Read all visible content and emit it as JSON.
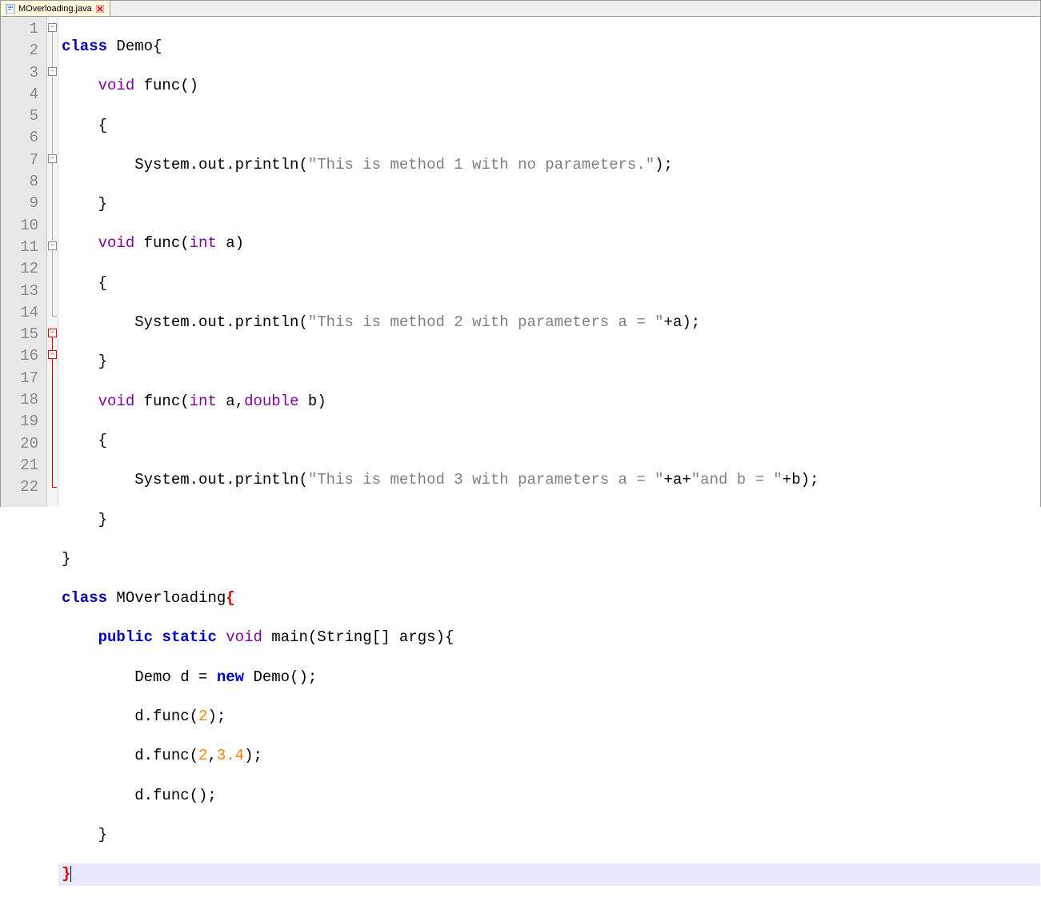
{
  "tab": {
    "filename": "MOverloading.java"
  },
  "gutter": {
    "lines": [
      "1",
      "2",
      "3",
      "4",
      "5",
      "6",
      "7",
      "8",
      "9",
      "10",
      "11",
      "12",
      "13",
      "14",
      "15",
      "16",
      "17",
      "18",
      "19",
      "20",
      "21",
      "22"
    ]
  },
  "code": {
    "l1": {
      "kw_class": "class",
      "name": "Demo",
      "brace": "{"
    },
    "l2": {
      "kw_void": "void",
      "name": "func",
      "paren": "()"
    },
    "l3": {
      "brace": "{"
    },
    "l4": {
      "sys": "System.out.println(",
      "str": "\"This is method 1 with no parameters.\"",
      "end": ");"
    },
    "l5": {
      "brace": "}"
    },
    "l6": {
      "kw_void": "void",
      "name": "func",
      "open": "(",
      "kw_int": "int",
      "a": " a",
      "close": ")"
    },
    "l7": {
      "brace": "{"
    },
    "l8": {
      "sys": "System.out.println(",
      "str": "\"This is method 2 with parameters a = \"",
      "plus1": "+",
      "a": "a",
      "end": ");"
    },
    "l9": {
      "brace": "}"
    },
    "l10": {
      "kw_void": "void",
      "name": "func",
      "open": "(",
      "kw_int": "int",
      "a": " a,",
      "kw_double": "double",
      "b": " b",
      "close": ")"
    },
    "l11": {
      "brace": "{"
    },
    "l12": {
      "sys": "System.out.println(",
      "str1": "\"This is method 3 with parameters a = \"",
      "plus1": "+",
      "a": "a",
      "plus2": "+",
      "str2": "\"and b = \"",
      "plus3": "+",
      "b": "b",
      "end": ");"
    },
    "l13": {
      "brace": "}"
    },
    "l14": {
      "brace": "}"
    },
    "l15": {
      "kw_class": "class",
      "name": "MOverloading",
      "brace": "{"
    },
    "l16": {
      "kw_public": "public",
      "kw_static": "static",
      "kw_void": "void",
      "main": "main",
      "open": "(",
      "str_t": "String",
      "arr": "[] args",
      "close": ")",
      "brace": "{"
    },
    "l17": {
      "demo": "Demo d = ",
      "kw_new": "new",
      "demo2": " Demo();"
    },
    "l18": {
      "pre": "d.func(",
      "n1": "2",
      "end": ");"
    },
    "l19": {
      "pre": "d.func(",
      "n1": "2",
      "comma": ",",
      "n2": "3.4",
      "end": ");"
    },
    "l20": {
      "txt": "d.func();"
    },
    "l21": {
      "brace": "}"
    },
    "l22": {
      "brace": "}"
    }
  }
}
